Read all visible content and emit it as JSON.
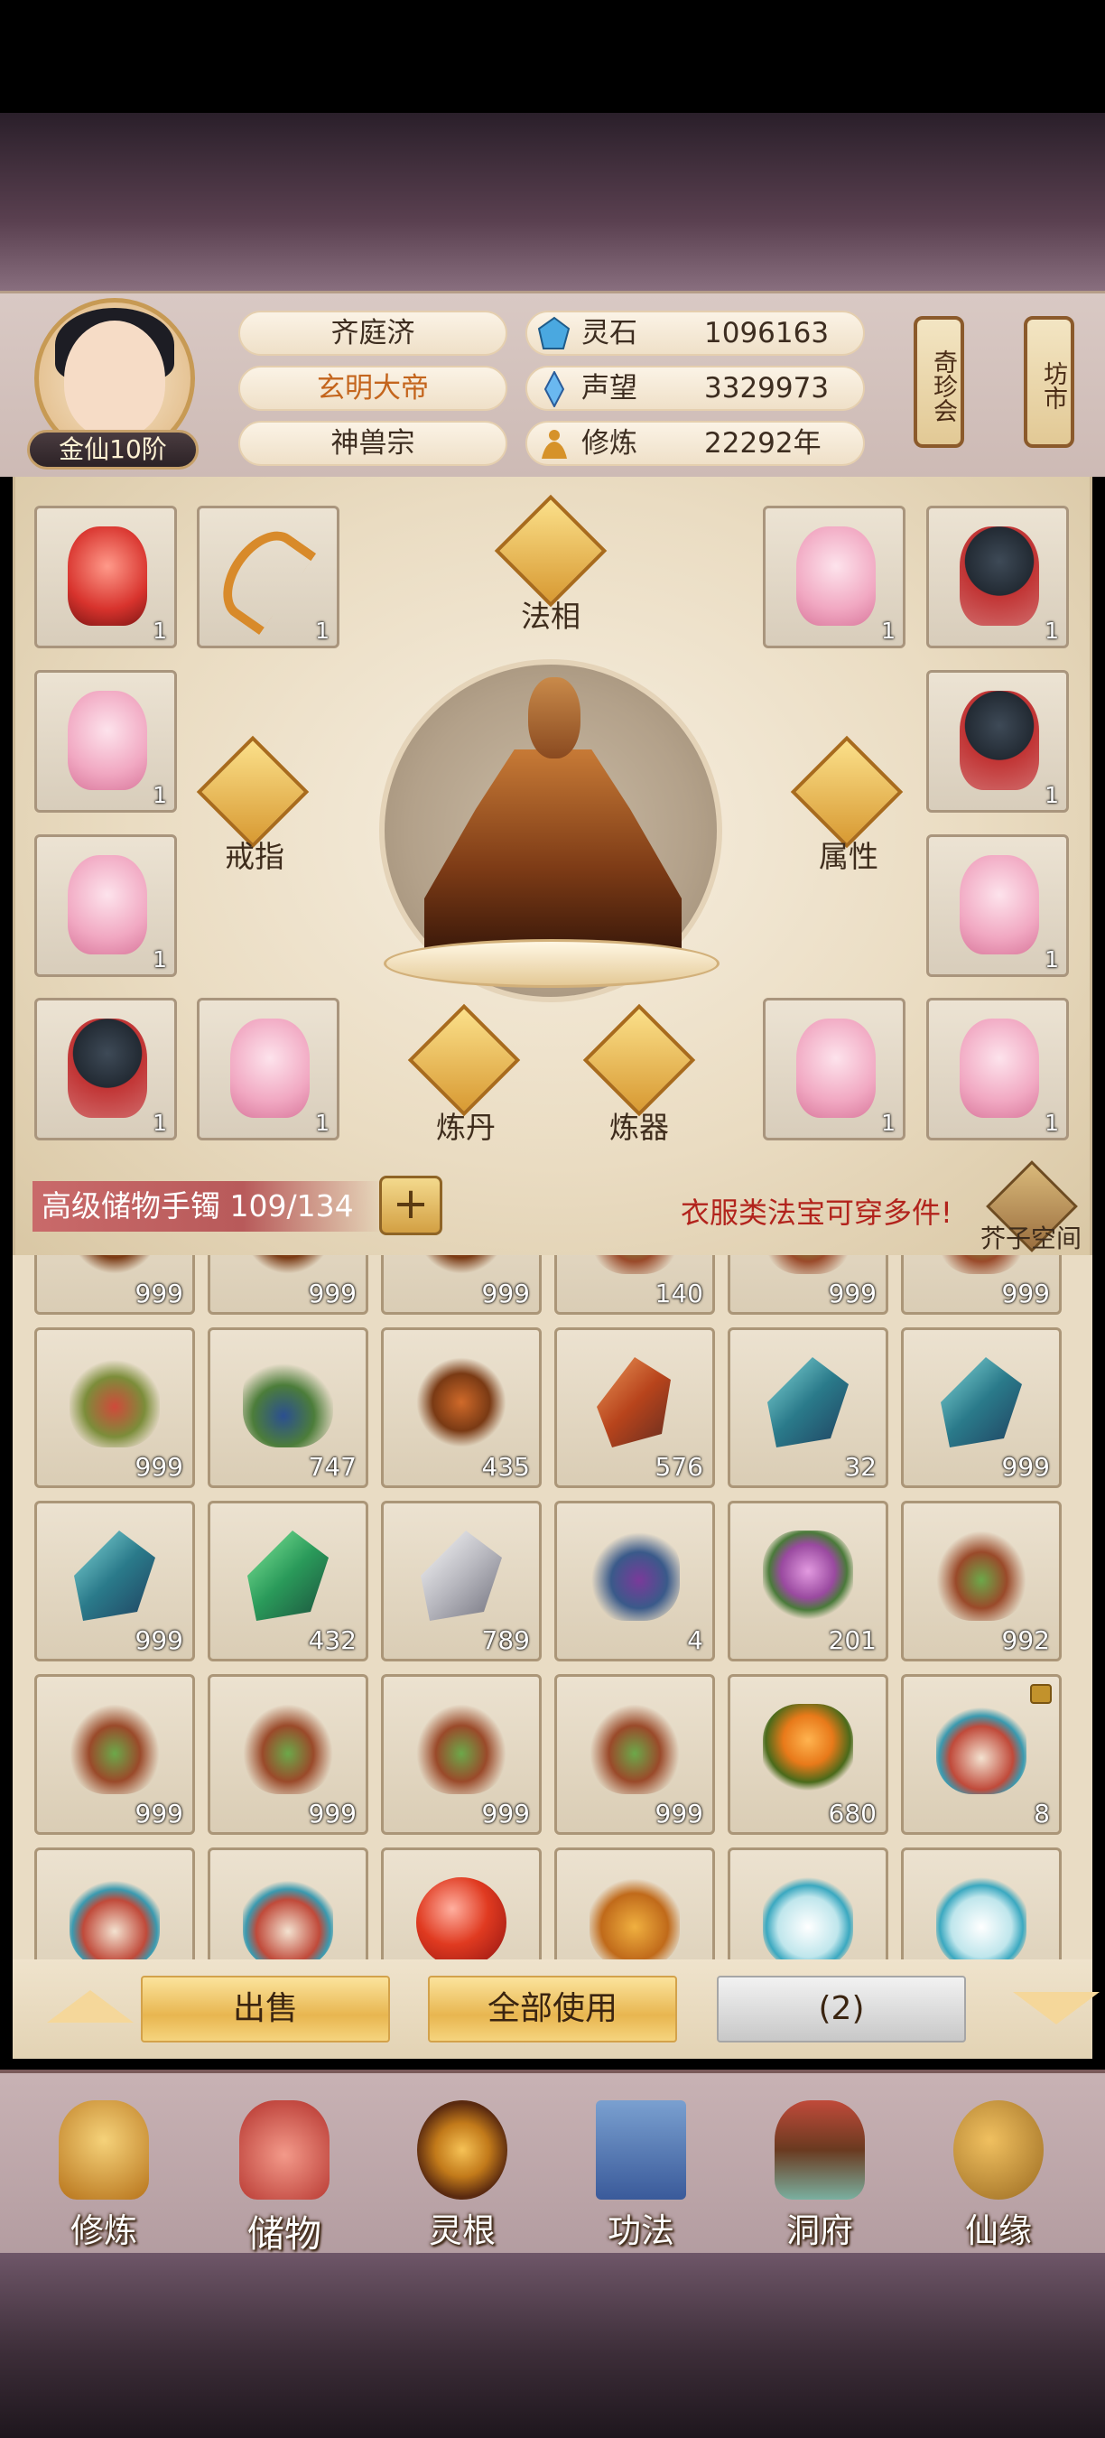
{
  "header": {
    "player_name": "齐庭济",
    "title": "玄明大帝",
    "sect": "神兽宗",
    "rank": "金仙10阶",
    "resources": [
      {
        "icon": "spirit-stone-icon",
        "label": "灵石",
        "value": "1096163"
      },
      {
        "icon": "prestige-icon",
        "label": "声望",
        "value": "3329973"
      },
      {
        "icon": "cultivation-icon",
        "label": "修炼",
        "value": "22292年"
      }
    ],
    "side_buttons": {
      "treasure": "奇珍会",
      "market": "坊市"
    }
  },
  "equipment": {
    "center_labels": {
      "faxiang": "法相",
      "ring": "戒指",
      "attribute": "属性",
      "alchemy": "炼丹",
      "forge": "炼器"
    },
    "left_slots": [
      {
        "item": "red-robe",
        "count": "1"
      },
      {
        "item": "bow",
        "count": "1"
      },
      {
        "item": "pink-robe",
        "count": "1"
      },
      {
        "item": "pink-robe",
        "count": "1"
      },
      {
        "item": "dark-robe",
        "count": "1"
      },
      {
        "item": "pink-robe",
        "count": "1"
      }
    ],
    "right_slots": [
      {
        "item": "pink-robe",
        "count": "1"
      },
      {
        "item": "dark-robe",
        "count": "1"
      },
      {
        "item": "dark-robe",
        "count": "1"
      },
      {
        "item": "pink-robe",
        "count": "1"
      },
      {
        "item": "pink-robe",
        "count": "1"
      },
      {
        "item": "pink-robe",
        "count": "1"
      }
    ]
  },
  "storage": {
    "bag_name": "高级储物手镯 109/134",
    "add_label": "+",
    "hint": "衣服类法宝可穿多件!",
    "jiezi_label": "芥子空间"
  },
  "items": [
    [
      "999",
      "999",
      "999",
      "140",
      "999",
      "999"
    ],
    [
      "999",
      "747",
      "435",
      "576",
      "32",
      "999"
    ],
    [
      "999",
      "432",
      "789",
      "4",
      "201",
      "992"
    ],
    [
      "999",
      "999",
      "999",
      "999",
      "680",
      "8"
    ],
    [
      "",
      "",
      "",
      "",
      "",
      ""
    ]
  ],
  "item_kinds": [
    [
      "it-root",
      "it-root",
      "it-root",
      "it-twig",
      "it-twig",
      "it-twig"
    ],
    [
      "it-herb",
      "it-fruit",
      "it-root",
      "it-redstone",
      "it-bluestone",
      "it-bluestone"
    ],
    [
      "it-bluestone",
      "it-greenstone",
      "it-greystone",
      "it-berry",
      "it-flower",
      "it-twig"
    ],
    [
      "it-twig",
      "it-twig",
      "it-twig",
      "it-twig",
      "it-bowl",
      "it-gourd"
    ],
    [
      "it-gourd",
      "it-gourd",
      "it-orb",
      "it-jar",
      "it-vase",
      "it-vase"
    ]
  ],
  "actions": {
    "sell": "出售",
    "use_all": "全部使用",
    "selected": "(2)"
  },
  "nav": [
    {
      "label": "修炼",
      "icon": "cultivate-icon"
    },
    {
      "label": "储物",
      "icon": "storage-bag-icon"
    },
    {
      "label": "灵根",
      "icon": "spirit-root-icon"
    },
    {
      "label": "功法",
      "icon": "technique-book-icon"
    },
    {
      "label": "洞府",
      "icon": "cave-mansion-icon"
    },
    {
      "label": "仙缘",
      "icon": "immortal-fate-icon"
    }
  ]
}
